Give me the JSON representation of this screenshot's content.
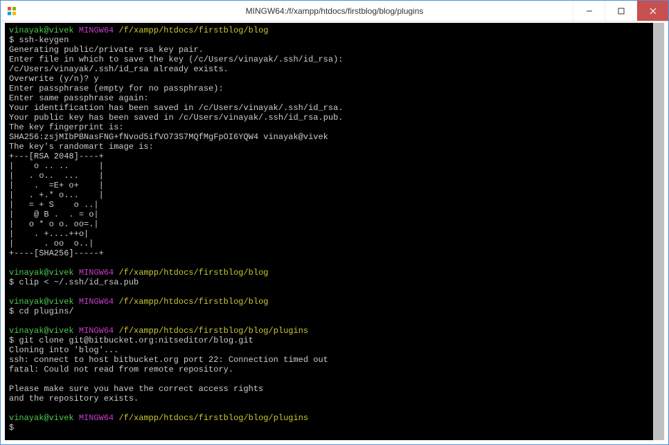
{
  "window": {
    "title": "MINGW64:/f/xampp/htdocs/firstblog/blog/plugins"
  },
  "terminal": {
    "blocks": [
      {
        "prompt": {
          "user": "vinayak@vivek",
          "env": "MINGW64",
          "path": "/f/xampp/htdocs/firstblog/blog"
        },
        "command": "$ ssh-keygen",
        "output": [
          "Generating public/private rsa key pair.",
          "Enter file in which to save the key (/c/Users/vinayak/.ssh/id_rsa):",
          "/c/Users/vinayak/.ssh/id_rsa already exists.",
          "Overwrite (y/n)? y",
          "Enter passphrase (empty for no passphrase):",
          "Enter same passphrase again:",
          "Your identification has been saved in /c/Users/vinayak/.ssh/id_rsa.",
          "Your public key has been saved in /c/Users/vinayak/.ssh/id_rsa.pub.",
          "The key fingerprint is:",
          "SHA256:zsjMIbPBNasFNG+fNvod5ifVO73S7MQfMgFpOI6YQW4 vinayak@vivek",
          "The key's randomart image is:",
          "+---[RSA 2048]----+",
          "|    o .. ..      |",
          "|   . o..  ...    |",
          "|    .  =E+ o+    |",
          "|   . +.* o...    |",
          "|   = + S    o ..|",
          "|    @ B .  . = o|",
          "|   o * o o. oo=.|",
          "|    . +....++o|",
          "|      . oo  o..|",
          "+----[SHA256]-----+"
        ]
      },
      {
        "prompt": {
          "user": "vinayak@vivek",
          "env": "MINGW64",
          "path": "/f/xampp/htdocs/firstblog/blog"
        },
        "command": "$ clip < ~/.ssh/id_rsa.pub",
        "output": []
      },
      {
        "prompt": {
          "user": "vinayak@vivek",
          "env": "MINGW64",
          "path": "/f/xampp/htdocs/firstblog/blog"
        },
        "command": "$ cd plugins/",
        "output": []
      },
      {
        "prompt": {
          "user": "vinayak@vivek",
          "env": "MINGW64",
          "path": "/f/xampp/htdocs/firstblog/blog/plugins"
        },
        "command": "$ git clone git@bitbucket.org:nitseditor/blog.git",
        "output": [
          "Cloning into 'blog'...",
          "ssh: connect to host bitbucket.org port 22: Connection timed out",
          "fatal: Could not read from remote repository.",
          "",
          "Please make sure you have the correct access rights",
          "and the repository exists."
        ]
      },
      {
        "prompt": {
          "user": "vinayak@vivek",
          "env": "MINGW64",
          "path": "/f/xampp/htdocs/firstblog/blog/plugins"
        },
        "command": "$",
        "output": []
      }
    ]
  }
}
